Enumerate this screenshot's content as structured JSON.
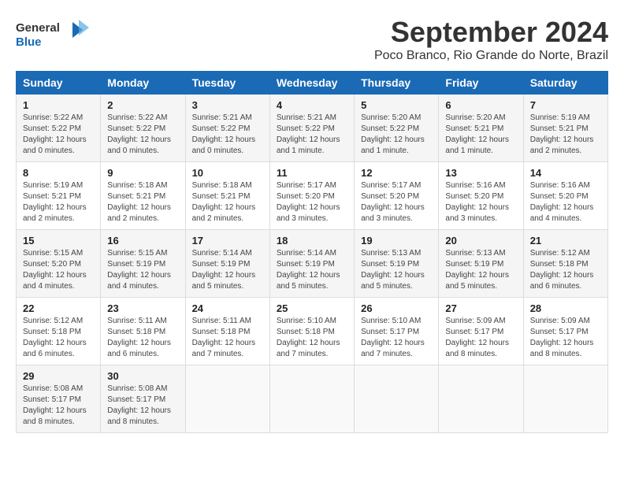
{
  "logo": {
    "line1": "General",
    "line2": "Blue"
  },
  "title": "September 2024",
  "location": "Poco Branco, Rio Grande do Norte, Brazil",
  "headers": [
    "Sunday",
    "Monday",
    "Tuesday",
    "Wednesday",
    "Thursday",
    "Friday",
    "Saturday"
  ],
  "weeks": [
    [
      {
        "day": "1",
        "sunrise": "5:22 AM",
        "sunset": "5:22 PM",
        "daylight": "12 hours and 0 minutes."
      },
      {
        "day": "2",
        "sunrise": "5:22 AM",
        "sunset": "5:22 PM",
        "daylight": "12 hours and 0 minutes."
      },
      {
        "day": "3",
        "sunrise": "5:21 AM",
        "sunset": "5:22 PM",
        "daylight": "12 hours and 0 minutes."
      },
      {
        "day": "4",
        "sunrise": "5:21 AM",
        "sunset": "5:22 PM",
        "daylight": "12 hours and 1 minute."
      },
      {
        "day": "5",
        "sunrise": "5:20 AM",
        "sunset": "5:22 PM",
        "daylight": "12 hours and 1 minute."
      },
      {
        "day": "6",
        "sunrise": "5:20 AM",
        "sunset": "5:21 PM",
        "daylight": "12 hours and 1 minute."
      },
      {
        "day": "7",
        "sunrise": "5:19 AM",
        "sunset": "5:21 PM",
        "daylight": "12 hours and 2 minutes."
      }
    ],
    [
      {
        "day": "8",
        "sunrise": "5:19 AM",
        "sunset": "5:21 PM",
        "daylight": "12 hours and 2 minutes."
      },
      {
        "day": "9",
        "sunrise": "5:18 AM",
        "sunset": "5:21 PM",
        "daylight": "12 hours and 2 minutes."
      },
      {
        "day": "10",
        "sunrise": "5:18 AM",
        "sunset": "5:21 PM",
        "daylight": "12 hours and 2 minutes."
      },
      {
        "day": "11",
        "sunrise": "5:17 AM",
        "sunset": "5:20 PM",
        "daylight": "12 hours and 3 minutes."
      },
      {
        "day": "12",
        "sunrise": "5:17 AM",
        "sunset": "5:20 PM",
        "daylight": "12 hours and 3 minutes."
      },
      {
        "day": "13",
        "sunrise": "5:16 AM",
        "sunset": "5:20 PM",
        "daylight": "12 hours and 3 minutes."
      },
      {
        "day": "14",
        "sunrise": "5:16 AM",
        "sunset": "5:20 PM",
        "daylight": "12 hours and 4 minutes."
      }
    ],
    [
      {
        "day": "15",
        "sunrise": "5:15 AM",
        "sunset": "5:20 PM",
        "daylight": "12 hours and 4 minutes."
      },
      {
        "day": "16",
        "sunrise": "5:15 AM",
        "sunset": "5:19 PM",
        "daylight": "12 hours and 4 minutes."
      },
      {
        "day": "17",
        "sunrise": "5:14 AM",
        "sunset": "5:19 PM",
        "daylight": "12 hours and 5 minutes."
      },
      {
        "day": "18",
        "sunrise": "5:14 AM",
        "sunset": "5:19 PM",
        "daylight": "12 hours and 5 minutes."
      },
      {
        "day": "19",
        "sunrise": "5:13 AM",
        "sunset": "5:19 PM",
        "daylight": "12 hours and 5 minutes."
      },
      {
        "day": "20",
        "sunrise": "5:13 AM",
        "sunset": "5:19 PM",
        "daylight": "12 hours and 5 minutes."
      },
      {
        "day": "21",
        "sunrise": "5:12 AM",
        "sunset": "5:18 PM",
        "daylight": "12 hours and 6 minutes."
      }
    ],
    [
      {
        "day": "22",
        "sunrise": "5:12 AM",
        "sunset": "5:18 PM",
        "daylight": "12 hours and 6 minutes."
      },
      {
        "day": "23",
        "sunrise": "5:11 AM",
        "sunset": "5:18 PM",
        "daylight": "12 hours and 6 minutes."
      },
      {
        "day": "24",
        "sunrise": "5:11 AM",
        "sunset": "5:18 PM",
        "daylight": "12 hours and 7 minutes."
      },
      {
        "day": "25",
        "sunrise": "5:10 AM",
        "sunset": "5:18 PM",
        "daylight": "12 hours and 7 minutes."
      },
      {
        "day": "26",
        "sunrise": "5:10 AM",
        "sunset": "5:17 PM",
        "daylight": "12 hours and 7 minutes."
      },
      {
        "day": "27",
        "sunrise": "5:09 AM",
        "sunset": "5:17 PM",
        "daylight": "12 hours and 8 minutes."
      },
      {
        "day": "28",
        "sunrise": "5:09 AM",
        "sunset": "5:17 PM",
        "daylight": "12 hours and 8 minutes."
      }
    ],
    [
      {
        "day": "29",
        "sunrise": "5:08 AM",
        "sunset": "5:17 PM",
        "daylight": "12 hours and 8 minutes."
      },
      {
        "day": "30",
        "sunrise": "5:08 AM",
        "sunset": "5:17 PM",
        "daylight": "12 hours and 8 minutes."
      },
      null,
      null,
      null,
      null,
      null
    ]
  ]
}
